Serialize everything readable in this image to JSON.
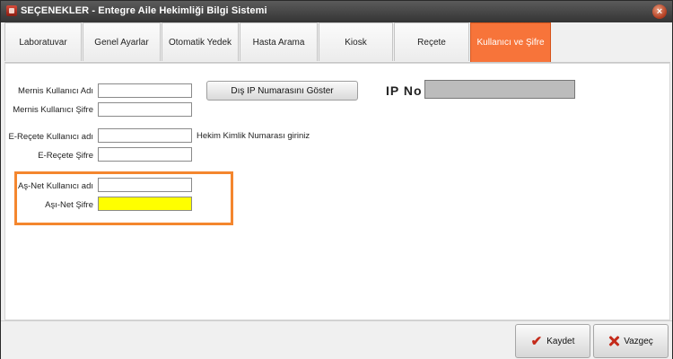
{
  "window": {
    "title": "SEÇENEKLER - Entegre Aile Hekimliği Bilgi Sistemi",
    "close_symbol": "×"
  },
  "tabs": [
    {
      "label": "Laboratuvar",
      "active": false
    },
    {
      "label": "Genel Ayarlar",
      "active": false
    },
    {
      "label": "Otomatik Yedek",
      "active": false
    },
    {
      "label": "Hasta Arama",
      "active": false
    },
    {
      "label": "Kiosk",
      "active": false
    },
    {
      "label": "Reçete",
      "active": false
    },
    {
      "label": "Kullanıcı ve Şifre",
      "active": true
    }
  ],
  "form": {
    "mernis_user_label": "Mernis Kullanıcı Adı",
    "mernis_user_value": "",
    "mernis_pass_label": "Mernis Kullanıcı Şifre",
    "mernis_pass_value": "",
    "erecete_user_label": "E-Reçete Kullanıcı adı",
    "erecete_user_value": "",
    "erecete_hint": "Hekim Kimlik Numarası giriniz",
    "erecete_pass_label": "E-Reçete Şifre",
    "erecete_pass_value": "",
    "asnet_user_label": "Aş-Net Kullanıcı adı",
    "asnet_user_value": "",
    "asnet_pass_label": "Aşı-Net Şifre",
    "asnet_pass_value": "",
    "show_ip_button": "Dış IP Numarasını Göster",
    "ip_label": "IP No",
    "ip_value": ""
  },
  "footer": {
    "save_label": "Kaydet",
    "cancel_label": "Vazgeç"
  },
  "colors": {
    "active_tab": "#f7743a",
    "highlight_border": "#f4862e",
    "focused_field": "#ffff00"
  },
  "icons": {
    "app": "app-icon",
    "close": "close-icon",
    "save": "check-icon",
    "cancel": "x-icon"
  }
}
